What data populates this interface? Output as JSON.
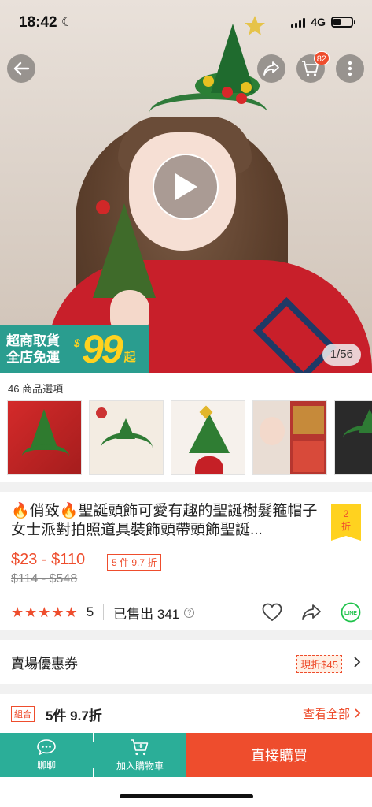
{
  "status_bar": {
    "time": "18:42",
    "network": "4G",
    "battery_level": 0.4
  },
  "header": {
    "cart_count": "82"
  },
  "hero": {
    "image_counter": "1/56",
    "promo": {
      "line1": "超商取貨",
      "line2": "全店免運",
      "currency": "$",
      "amount": "99",
      "suffix": "起"
    }
  },
  "variations": {
    "label": "46 商品選項"
  },
  "product": {
    "title": "🔥俏致🔥聖誕頭飾可愛有趣的聖誕樹髮箍帽子女士派對拍照道具裝飾頭帶頭飾聖誕...",
    "discount_tag": {
      "value": "2",
      "unit": "折"
    },
    "price_range": "$23 - $110",
    "bulk_offer": "5 件 9.7 折",
    "original_price": "$114 - $548",
    "rating": "5",
    "rating_stars": 5,
    "sold_label": "已售出 341"
  },
  "vouchers": {
    "label": "賣場優惠券",
    "tag": "現折$45"
  },
  "bundle": {
    "tag": "組合",
    "title": "5件 9.7折",
    "see_all": "查看全部"
  },
  "bottom_bar": {
    "chat_label": "聊聊",
    "add_to_cart_label": "加入購物車",
    "buy_now_label": "直接購買"
  },
  "colors": {
    "brand_orange": "#ee4d2d",
    "teal": "#2bae98",
    "promo_yellow": "#ffd21f"
  }
}
